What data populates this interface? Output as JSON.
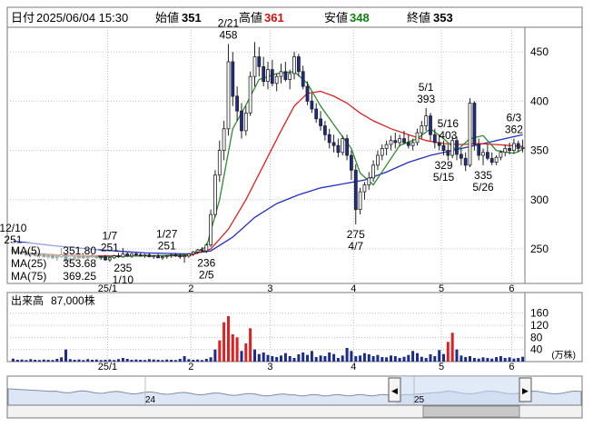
{
  "header": {
    "date_label": "日付",
    "datetime": "2025/06/04 15:30",
    "open_label": "始値",
    "open": "351",
    "high_label": "高値",
    "high": "361",
    "low_label": "安値",
    "low": "348",
    "close_label": "終値",
    "close": "353"
  },
  "colors": {
    "up": "#ffffff",
    "down": "#1c2b8c",
    "ma5": "#2e8b2e",
    "ma25": "#e02020",
    "ma75": "#2030c8",
    "volume": "#1c2b8c",
    "volume_spike": "#e02020",
    "high_value": "#d01010",
    "low_value": "#108010"
  },
  "ma_legend": [
    {
      "label": "MA(5)",
      "value": "351.80",
      "color": "#2e8b2e"
    },
    {
      "label": "MA(25)",
      "value": "353.68",
      "color": "#e02020"
    },
    {
      "label": "MA(75)",
      "value": "369.25",
      "color": "#2030c8"
    }
  ],
  "volume_label": "出来高",
  "volume_value": "87,000株",
  "volume_unit": "(万株)",
  "nav": {
    "left_tick": "24",
    "right_tick": "25",
    "scroll_left_icon": "◀",
    "scroll_right_icon": "▶"
  },
  "chart_data": [
    {
      "type": "candlestick",
      "y_ticks": [
        "250",
        "300",
        "350",
        "400",
        "450"
      ],
      "ylim": [
        215,
        475
      ],
      "x_ticks": [
        "25/1",
        "2",
        "3",
        "4",
        "5",
        "6"
      ],
      "annotations": [
        {
          "date": "12/10",
          "value": "251"
        },
        {
          "date": "1/7",
          "value": "251"
        },
        {
          "date": "1/27",
          "value": "251"
        },
        {
          "date": "2/21",
          "value": "458"
        },
        {
          "date": "2/5",
          "value": "236"
        },
        {
          "date": "4/7",
          "value": "275"
        },
        {
          "date": "5/1",
          "value": "393"
        },
        {
          "date": "5/16",
          "value": "403"
        },
        {
          "date": "5/15",
          "value": "329"
        },
        {
          "date": "5/26",
          "value": "335"
        },
        {
          "date": "6/3",
          "value": "362"
        },
        {
          "date": "1/10",
          "value": "235"
        }
      ],
      "candles": [
        [
          249,
          250,
          246,
          247
        ],
        [
          248,
          251,
          245,
          246
        ],
        [
          246,
          248,
          244,
          247
        ],
        [
          247,
          249,
          243,
          244
        ],
        [
          244,
          246,
          242,
          245
        ],
        [
          245,
          247,
          243,
          243
        ],
        [
          243,
          245,
          241,
          244
        ],
        [
          244,
          246,
          242,
          242
        ],
        [
          242,
          244,
          240,
          243
        ],
        [
          243,
          245,
          240,
          241
        ],
        [
          241,
          243,
          238,
          242
        ],
        [
          242,
          251,
          241,
          244
        ],
        [
          244,
          246,
          235,
          238
        ],
        [
          238,
          241,
          236,
          240
        ],
        [
          240,
          243,
          239,
          241
        ],
        [
          241,
          244,
          240,
          242
        ],
        [
          242,
          245,
          240,
          241
        ],
        [
          241,
          243,
          239,
          242
        ],
        [
          242,
          245,
          241,
          243
        ],
        [
          243,
          244,
          240,
          241
        ],
        [
          241,
          243,
          239,
          242
        ],
        [
          242,
          244,
          238,
          239
        ],
        [
          239,
          242,
          237,
          241
        ],
        [
          241,
          244,
          240,
          243
        ],
        [
          243,
          246,
          241,
          242
        ],
        [
          242,
          251,
          241,
          245
        ],
        [
          245,
          247,
          242,
          243
        ],
        [
          243,
          246,
          241,
          245
        ],
        [
          245,
          247,
          243,
          244
        ],
        [
          244,
          246,
          242,
          243
        ],
        [
          243,
          245,
          241,
          244
        ],
        [
          244,
          246,
          242,
          242
        ],
        [
          242,
          244,
          240,
          243
        ],
        [
          243,
          245,
          241,
          241
        ],
        [
          241,
          243,
          239,
          242
        ],
        [
          242,
          244,
          240,
          243
        ],
        [
          243,
          245,
          241,
          244
        ],
        [
          244,
          246,
          242,
          243
        ],
        [
          243,
          245,
          240,
          242
        ],
        [
          242,
          244,
          236,
          243
        ],
        [
          243,
          246,
          241,
          245
        ],
        [
          245,
          248,
          243,
          247
        ],
        [
          247,
          250,
          245,
          249
        ],
        [
          249,
          252,
          247,
          248
        ],
        [
          248,
          256,
          246,
          254
        ],
        [
          254,
          290,
          252,
          285
        ],
        [
          285,
          330,
          282,
          325
        ],
        [
          325,
          360,
          318,
          350
        ],
        [
          350,
          380,
          340,
          372
        ],
        [
          372,
          458,
          365,
          440
        ],
        [
          440,
          450,
          395,
          405
        ],
        [
          405,
          415,
          380,
          390
        ],
        [
          390,
          398,
          362,
          370
        ],
        [
          370,
          395,
          365,
          388
        ],
        [
          388,
          430,
          385,
          425
        ],
        [
          425,
          460,
          415,
          445
        ],
        [
          445,
          455,
          425,
          435
        ],
        [
          435,
          445,
          415,
          420
        ],
        [
          420,
          440,
          412,
          432
        ],
        [
          432,
          442,
          415,
          418
        ],
        [
          418,
          428,
          410,
          425
        ],
        [
          425,
          438,
          418,
          430
        ],
        [
          430,
          440,
          420,
          422
        ],
        [
          422,
          432,
          412,
          428
        ],
        [
          428,
          450,
          422,
          445
        ],
        [
          445,
          448,
          425,
          430
        ],
        [
          430,
          436,
          412,
          415
        ],
        [
          415,
          420,
          396,
          400
        ],
        [
          400,
          408,
          388,
          392
        ],
        [
          392,
          398,
          378,
          382
        ],
        [
          382,
          390,
          370,
          375
        ],
        [
          375,
          380,
          360,
          366
        ],
        [
          366,
          372,
          352,
          358
        ],
        [
          358,
          366,
          348,
          355
        ],
        [
          355,
          362,
          343,
          348
        ],
        [
          348,
          365,
          345,
          362
        ],
        [
          362,
          366,
          340,
          345
        ],
        [
          345,
          350,
          320,
          330
        ],
        [
          330,
          336,
          275,
          290
        ],
        [
          290,
          312,
          285,
          308
        ],
        [
          308,
          318,
          300,
          315
        ],
        [
          315,
          328,
          310,
          322
        ],
        [
          322,
          340,
          318,
          335
        ],
        [
          335,
          350,
          330,
          345
        ],
        [
          345,
          356,
          340,
          352
        ],
        [
          352,
          360,
          345,
          356
        ],
        [
          356,
          365,
          350,
          360
        ],
        [
          360,
          368,
          352,
          358
        ],
        [
          358,
          366,
          354,
          362
        ],
        [
          362,
          370,
          356,
          358
        ],
        [
          358,
          366,
          352,
          355
        ],
        [
          355,
          362,
          350,
          358
        ],
        [
          358,
          372,
          355,
          368
        ],
        [
          368,
          380,
          362,
          375
        ],
        [
          375,
          393,
          370,
          385
        ],
        [
          385,
          388,
          360,
          366
        ],
        [
          366,
          372,
          352,
          358
        ],
        [
          358,
          366,
          350,
          355
        ],
        [
          355,
          360,
          345,
          350
        ],
        [
          350,
          356,
          340,
          345
        ],
        [
          345,
          365,
          342,
          360
        ],
        [
          360,
          364,
          340,
          346
        ],
        [
          346,
          352,
          335,
          342
        ],
        [
          342,
          348,
          329,
          335
        ],
        [
          335,
          403,
          333,
          398
        ],
        [
          398,
          400,
          350,
          356
        ],
        [
          356,
          362,
          340,
          345
        ],
        [
          345,
          352,
          335,
          348
        ],
        [
          348,
          356,
          340,
          342
        ],
        [
          342,
          348,
          335,
          338
        ],
        [
          338,
          345,
          335,
          343
        ],
        [
          343,
          350,
          340,
          348
        ],
        [
          348,
          356,
          344,
          352
        ],
        [
          352,
          358,
          346,
          350
        ],
        [
          350,
          362,
          347,
          357
        ],
        [
          357,
          360,
          348,
          352
        ],
        [
          352,
          361,
          348,
          353
        ]
      ],
      "ma5": [
        [
          0,
          247
        ],
        [
          10,
          243
        ],
        [
          20,
          242
        ],
        [
          30,
          243
        ],
        [
          40,
          244
        ],
        [
          44,
          252
        ],
        [
          47,
          300
        ],
        [
          50,
          372
        ],
        [
          53,
          396
        ],
        [
          56,
          422
        ],
        [
          60,
          428
        ],
        [
          64,
          430
        ],
        [
          67,
          418
        ],
        [
          70,
          395
        ],
        [
          74,
          370
        ],
        [
          77,
          352
        ],
        [
          79,
          327
        ],
        [
          82,
          315
        ],
        [
          85,
          335
        ],
        [
          88,
          355
        ],
        [
          92,
          362
        ],
        [
          95,
          372
        ],
        [
          98,
          362
        ],
        [
          101,
          350
        ],
        [
          104,
          362
        ],
        [
          107,
          365
        ],
        [
          110,
          350
        ],
        [
          114,
          347
        ],
        [
          116,
          351
        ]
      ],
      "ma25": [
        [
          0,
          247
        ],
        [
          10,
          244
        ],
        [
          20,
          243
        ],
        [
          30,
          243
        ],
        [
          40,
          243
        ],
        [
          45,
          250
        ],
        [
          49,
          270
        ],
        [
          53,
          300
        ],
        [
          57,
          335
        ],
        [
          61,
          370
        ],
        [
          64,
          395
        ],
        [
          67,
          408
        ],
        [
          70,
          410
        ],
        [
          73,
          405
        ],
        [
          76,
          398
        ],
        [
          79,
          388
        ],
        [
          82,
          380
        ],
        [
          86,
          372
        ],
        [
          90,
          366
        ],
        [
          94,
          360
        ],
        [
          98,
          357
        ],
        [
          102,
          356
        ],
        [
          106,
          357
        ],
        [
          110,
          356
        ],
        [
          116,
          354
        ]
      ],
      "ma75": [
        [
          0,
          258
        ],
        [
          10,
          253
        ],
        [
          20,
          249
        ],
        [
          30,
          246
        ],
        [
          40,
          245
        ],
        [
          45,
          248
        ],
        [
          50,
          262
        ],
        [
          55,
          282
        ],
        [
          60,
          296
        ],
        [
          65,
          305
        ],
        [
          70,
          312
        ],
        [
          75,
          316
        ],
        [
          80,
          320
        ],
        [
          85,
          328
        ],
        [
          90,
          338
        ],
        [
          95,
          345
        ],
        [
          100,
          350
        ],
        [
          105,
          355
        ],
        [
          110,
          360
        ],
        [
          116,
          366
        ]
      ],
      "spikes": [
        12,
        39,
        77
      ]
    },
    {
      "type": "bar",
      "name": "volume",
      "y_ticks": [
        "40",
        "80",
        "120",
        "160"
      ],
      "ylim": [
        0,
        180
      ],
      "x_ticks": [
        "25/1",
        "2",
        "3",
        "4",
        "5",
        "6"
      ],
      "values": [
        10,
        6,
        7,
        5,
        8,
        6,
        5,
        7,
        6,
        5,
        9,
        14,
        40,
        8,
        6,
        7,
        5,
        8,
        6,
        7,
        5,
        6,
        7,
        5,
        8,
        12,
        9,
        6,
        7,
        6,
        5,
        8,
        7,
        6,
        5,
        7,
        6,
        5,
        9,
        18,
        8,
        6,
        7,
        5,
        9,
        14,
        40,
        70,
        130,
        150,
        90,
        80,
        35,
        60,
        110,
        40,
        25,
        30,
        22,
        18,
        15,
        20,
        28,
        18,
        12,
        24,
        30,
        22,
        35,
        15,
        20,
        18,
        30,
        25,
        12,
        20,
        45,
        35,
        18,
        20,
        28,
        24,
        18,
        22,
        15,
        14,
        20,
        18,
        12,
        16,
        22,
        35,
        28,
        16,
        12,
        24,
        18,
        38,
        25,
        65,
        95,
        40,
        20,
        15,
        18,
        12,
        10,
        14,
        12,
        10,
        15,
        18,
        12,
        14,
        10,
        12,
        16
      ]
    }
  ]
}
